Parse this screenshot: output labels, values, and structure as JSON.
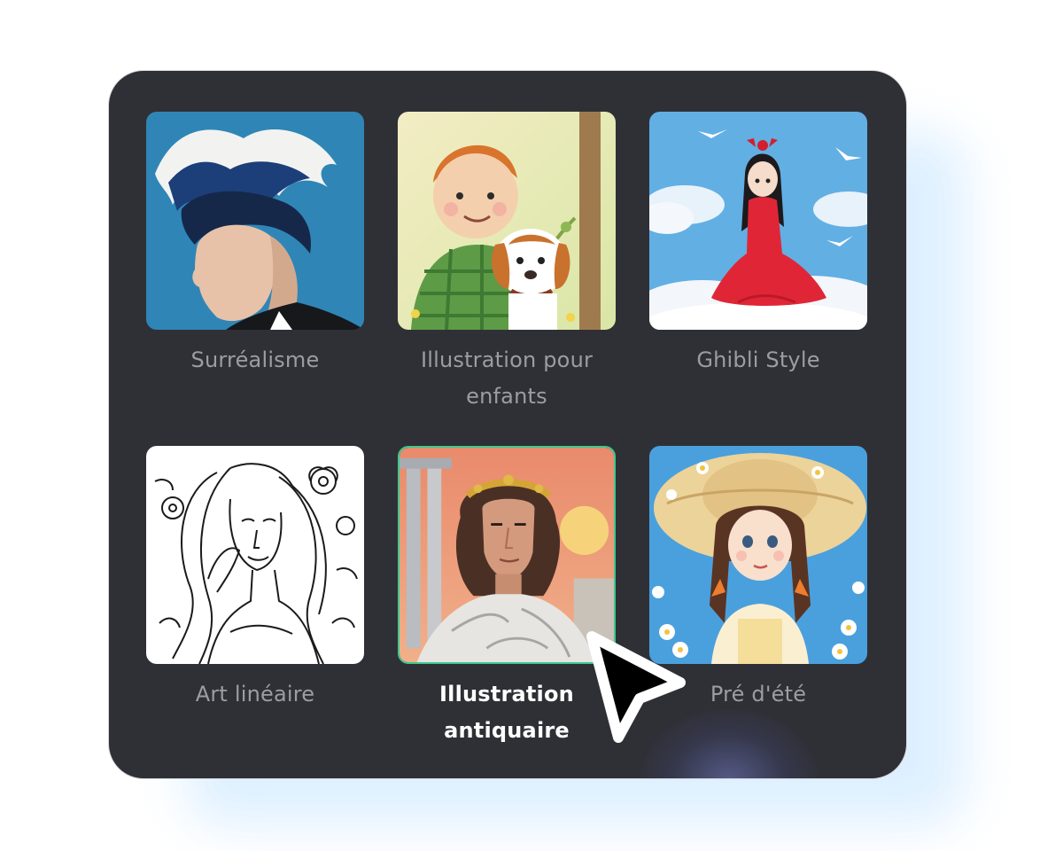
{
  "styles": [
    {
      "label": "Surréalisme",
      "icon": "surrealism-portrait-image"
    },
    {
      "label": "Illustration pour enfants",
      "icon": "children-illustration-image"
    },
    {
      "label": "Ghibli Style",
      "icon": "ghibli-style-image"
    },
    {
      "label": "Art linéaire",
      "icon": "line-art-image"
    },
    {
      "label": "Illustration antiquaire",
      "icon": "antique-illustration-image"
    },
    {
      "label": "Pré d'été",
      "icon": "summer-meadow-image"
    }
  ],
  "selected_style": "Illustration antiquaire",
  "colors": {
    "panel": "#2f3036",
    "selected_border": "#3ec88f",
    "label": "#9c9da3",
    "selected_label": "#ffffff"
  }
}
